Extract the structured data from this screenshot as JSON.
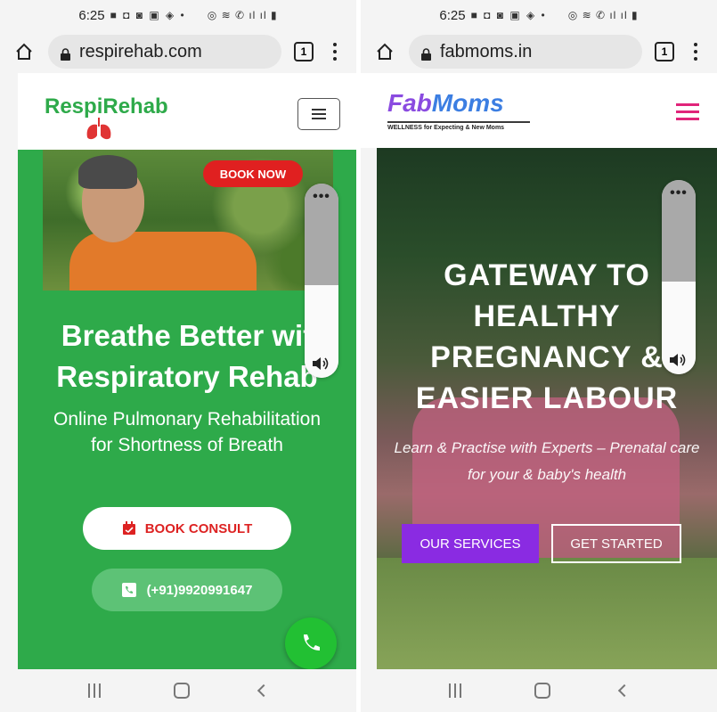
{
  "left_phone": {
    "status": {
      "time": "6:25"
    },
    "browser": {
      "url": "respirehab.com",
      "tab_count": "1"
    },
    "site": {
      "logo_text": "RespiRehab",
      "book_now": "BOOK NOW",
      "headline_line1": "Breathe Better wit",
      "headline_line2": "Respiratory Rehab",
      "subtitle": "Online Pulmonary Rehabilitation for Shortness of Breath",
      "book_consult": "BOOK CONSULT",
      "phone": "(+91)9920991647"
    },
    "volume_overlay": {
      "dots": "•••",
      "level": 0.48
    }
  },
  "right_phone": {
    "status": {
      "time": "6:25"
    },
    "browser": {
      "url": "fabmoms.in",
      "tab_count": "1"
    },
    "site": {
      "logo_fab": "Fab",
      "logo_moms": "Moms",
      "tagline": "WELLNESS for Expecting & New Moms",
      "headline_line1": "GATEWAY TO",
      "headline_line2": "HEALTHY",
      "headline_line3": "PREGNANCY &",
      "headline_line4": "EASIER LABOUR",
      "subtitle": "Learn & Practise with Experts – Prenatal care for your & baby's health",
      "our_services": "OUR SERVICES",
      "get_started": "GET STARTED"
    },
    "volume_overlay": {
      "dots": "•••",
      "level": 0.48
    }
  },
  "colors": {
    "respirehab_green": "#2eaa4a",
    "book_red": "#e02020",
    "fabmoms_purple": "#8a2be2",
    "fabmoms_pink": "#e0247a"
  }
}
